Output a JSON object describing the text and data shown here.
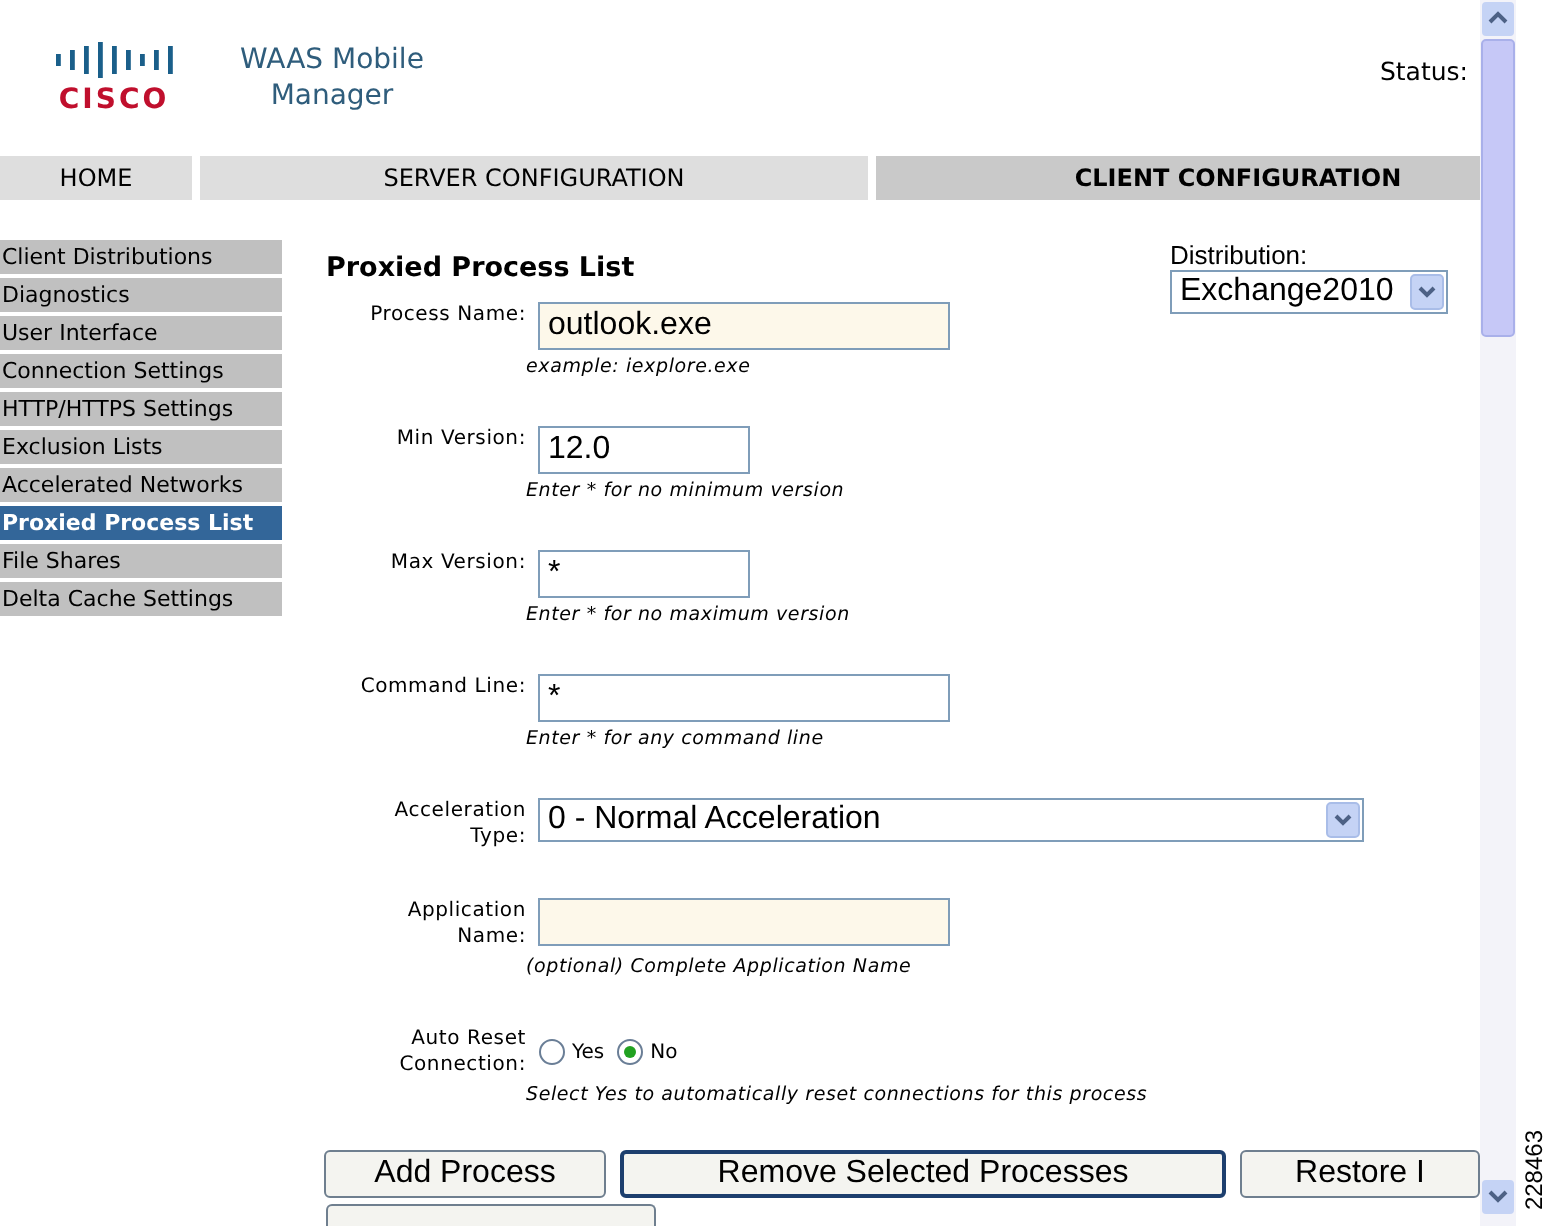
{
  "header": {
    "logo_wordmark": "CISCO",
    "app_title": "WAAS Mobile Manager",
    "status_label": "Status:"
  },
  "nav_tabs": [
    {
      "label": "HOME",
      "selected": false
    },
    {
      "label": "SERVER CONFIGURATION",
      "selected": false
    },
    {
      "label": "CLIENT CONFIGURATION",
      "selected": true
    }
  ],
  "sidebar": {
    "items": [
      {
        "label": "Client Distributions",
        "selected": false
      },
      {
        "label": "Diagnostics",
        "selected": false
      },
      {
        "label": "User Interface",
        "selected": false
      },
      {
        "label": "Connection Settings",
        "selected": false
      },
      {
        "label": "HTTP/HTTPS Settings",
        "selected": false
      },
      {
        "label": "Exclusion Lists",
        "selected": false
      },
      {
        "label": "Accelerated Networks",
        "selected": false
      },
      {
        "label": "Proxied Process List",
        "selected": true
      },
      {
        "label": "File Shares",
        "selected": false
      },
      {
        "label": "Delta Cache Settings",
        "selected": false
      }
    ]
  },
  "page_title": "Proxied Process List",
  "distribution": {
    "label": "Distribution:",
    "value": "Exchange2010"
  },
  "fields": [
    {
      "kind": "text",
      "label": "Process Name:",
      "value": "outlook.exe",
      "highlighted": true,
      "hint": "example: iexplore.exe"
    },
    {
      "kind": "text",
      "label": "Min Version:",
      "value": "12.0",
      "highlighted": false,
      "hint": "Enter * for no minimum version"
    },
    {
      "kind": "text",
      "label": "Max Version:",
      "value": "*",
      "highlighted": false,
      "hint": "Enter * for no maximum version"
    },
    {
      "kind": "text",
      "label": "Command Line:",
      "value": "*",
      "highlighted": false,
      "hint": "Enter * for any command line"
    },
    {
      "kind": "select",
      "label": "Acceleration Type:",
      "value": "0 - Normal Acceleration"
    },
    {
      "kind": "text",
      "label": "Application Name:",
      "highlighted": true,
      "hint": "(optional) Complete Application Name"
    },
    {
      "kind": "radio",
      "label": "Auto Reset Connection:",
      "options": [
        {
          "label": "Yes",
          "selected": false
        },
        {
          "label": "No",
          "selected": true
        }
      ],
      "hint": "Select Yes to automatically reset connections for this process"
    }
  ],
  "buttons": [
    {
      "label": "Add Process",
      "focused": false
    },
    {
      "label": "Remove Selected Processes",
      "focused": true
    },
    {
      "label": "Restore I",
      "focused": false
    }
  ],
  "figure_id": "228463"
}
